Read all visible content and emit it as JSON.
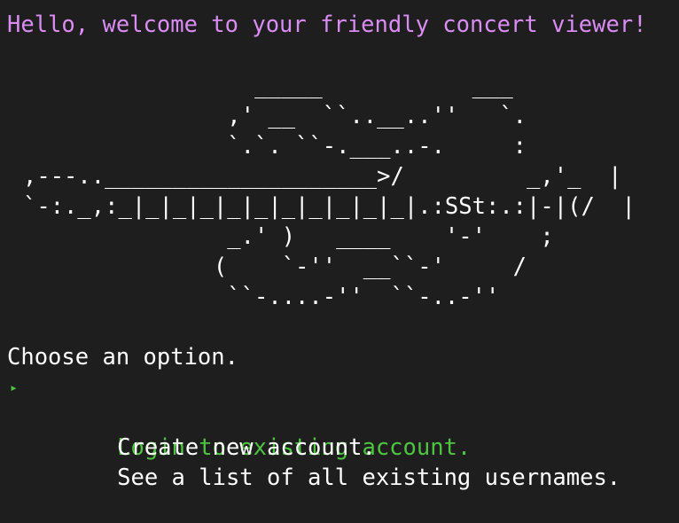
{
  "welcome_text": "Hello, welcome to your friendly concert viewer!",
  "ascii_art": "                 _____           ___\n               ,' __  ``..__..''   `.\n               `.`. ``-.___..-.     :\n,---..____________________>/         _,'_  |\n`-:._,:_|_|_|_|_|_|_|_|_|_|_|.:SSt:.:|-|(/  |\n               _.' )   ____    '-'    ;\n              (    `-''  __``-'     /\n               ``-....-''  ``-..-''",
  "prompt": "Choose an option.",
  "pointer_glyph": "▸",
  "menu": {
    "selected_index": 0,
    "items": [
      {
        "label": "Login to existing account."
      },
      {
        "label": "Create new account."
      },
      {
        "label": "See a list of all existing usernames."
      }
    ]
  },
  "colors": {
    "background": "#1e1e1e",
    "welcome": "#d98cf5",
    "selected": "#4ec540",
    "text": "#ffffff"
  }
}
